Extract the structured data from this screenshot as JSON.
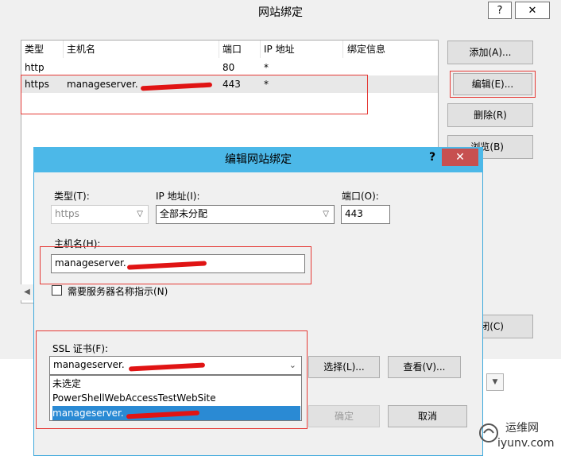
{
  "parent": {
    "title": "网站绑定",
    "help": "?",
    "close": "✕",
    "columns": [
      "类型",
      "主机名",
      "端口",
      "IP 地址",
      "绑定信息"
    ],
    "rows": [
      {
        "type": "http",
        "host": "",
        "port": "80",
        "ip": "*"
      },
      {
        "type": "https",
        "host": "manageserver.",
        "port": "443",
        "ip": "*"
      }
    ],
    "buttons": {
      "add": "添加(A)...",
      "edit": "编辑(E)...",
      "remove": "删除(R)",
      "browse": "浏览(B)",
      "close": "闭(C)"
    }
  },
  "child": {
    "title": "编辑网站绑定",
    "help": "?",
    "close": "✕",
    "type_label": "类型(T):",
    "type_value": "https",
    "ip_label": "IP 地址(I):",
    "ip_value": "全部未分配",
    "port_label": "端口(O):",
    "port_value": "443",
    "host_label": "主机名(H):",
    "host_value": "manageserver.",
    "sni_label": "需要服务器名称指示(N)",
    "ssl_label": "SSL 证书(F):",
    "ssl_value": "manageserver.",
    "ssl_options": [
      "未选定",
      "PowerShellWebAccessTestWebSite",
      "manageserver."
    ],
    "select_button": "选择(L)...",
    "view_button": "查看(V)...",
    "ok_button": "确定",
    "cancel_button": "取消"
  },
  "watermark": {
    "cn": "运维网",
    "en": "iyunv.com"
  },
  "colors": {
    "highlight_red": "#e53935",
    "titlebar_blue": "#4cb8e8",
    "selection_blue": "#2a8ad4",
    "close_red": "#c75050"
  }
}
